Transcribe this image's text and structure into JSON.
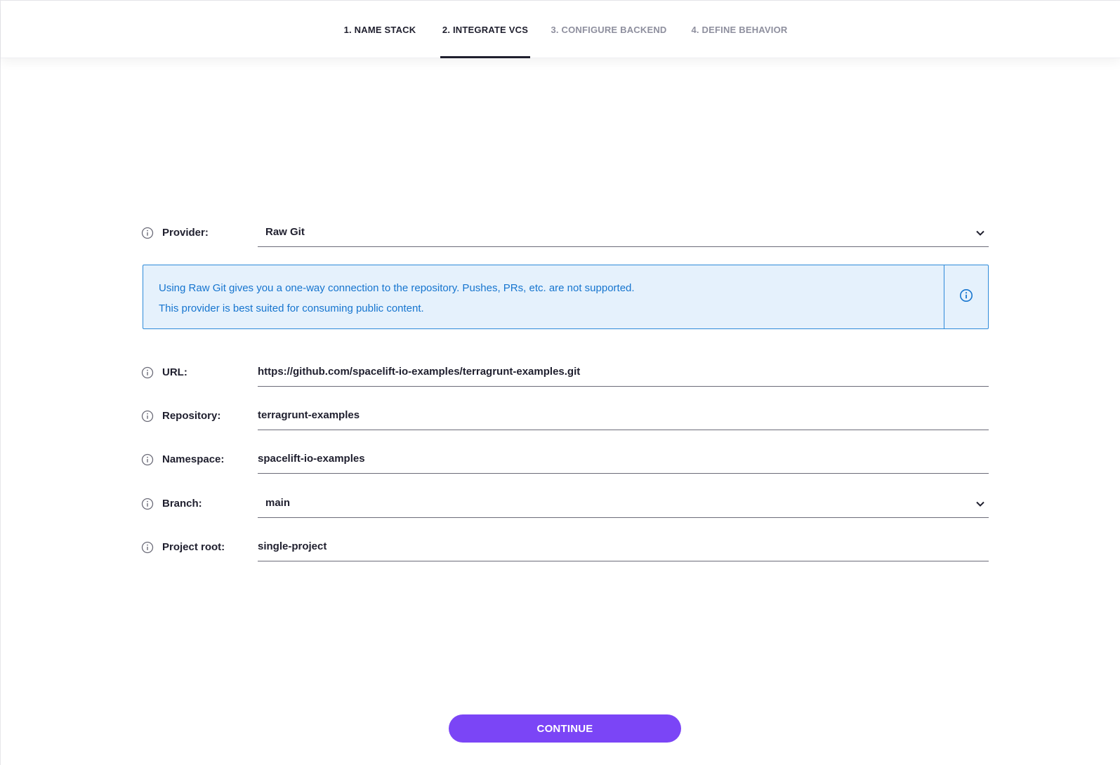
{
  "stepper": {
    "steps": [
      {
        "label": "1. Name stack",
        "state": "done"
      },
      {
        "label": "2. Integrate VCS",
        "state": "active"
      },
      {
        "label": "3. Configure backend",
        "state": "todo"
      },
      {
        "label": "4. Define behavior",
        "state": "todo"
      }
    ]
  },
  "form": {
    "provider": {
      "label": "Provider:",
      "value": "Raw Git"
    },
    "banner": {
      "line1": "Using Raw Git gives you a one-way connection to the repository. Pushes, PRs, etc. are not supported.",
      "line2": "This provider is best suited for consuming public content."
    },
    "url": {
      "label": "URL:",
      "value": "https://github.com/spacelift-io-examples/terragrunt-examples.git"
    },
    "repository": {
      "label": "Repository:",
      "value": "terragrunt-examples"
    },
    "namespace": {
      "label": "Namespace:",
      "value": "spacelift-io-examples"
    },
    "branch": {
      "label": "Branch:",
      "value": "main"
    },
    "project_root": {
      "label": "Project root:",
      "value": "single-project"
    }
  },
  "actions": {
    "continue_label": "Continue"
  },
  "colors": {
    "accent": "#7b45f6",
    "info_text": "#1675cf",
    "info_border": "#2d8ad9",
    "info_bg": "#e5f1fc",
    "inactive_step": "#8e8f9e"
  },
  "icons": {
    "field_info": "info-circle-icon",
    "dropdown": "chevron-down-icon"
  }
}
